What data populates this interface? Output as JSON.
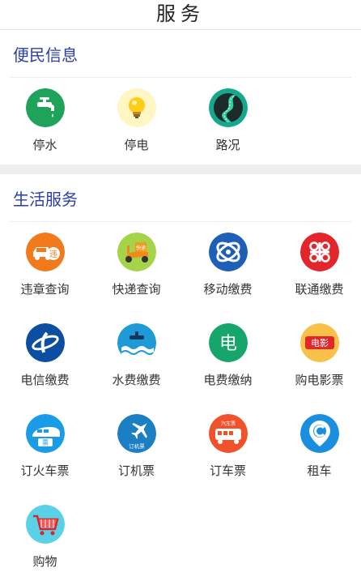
{
  "header": {
    "title": "服务"
  },
  "sections": [
    {
      "title": "便民信息",
      "items": [
        {
          "label": "停水",
          "icon": "water-tap-icon",
          "color": "#1fa35b"
        },
        {
          "label": "停电",
          "icon": "light-bulb-icon",
          "color": "#fff3b0"
        },
        {
          "label": "路况",
          "icon": "road-icon",
          "color": "#159a84"
        }
      ]
    },
    {
      "title": "生活服务",
      "items": [
        {
          "label": "违章查询",
          "icon": "car-violation-icon",
          "color": "#f07a1c"
        },
        {
          "label": "快递查询",
          "icon": "delivery-scooter-icon",
          "color": "#a5d34a"
        },
        {
          "label": "移动缴费",
          "icon": "china-mobile-icon",
          "color": "#1e5fb8"
        },
        {
          "label": "联通缴费",
          "icon": "china-unicom-icon",
          "color": "#e3262c"
        },
        {
          "label": "电信缴费",
          "icon": "china-telecom-icon",
          "color": "#0b4ea2"
        },
        {
          "label": "水费缴费",
          "icon": "water-bill-icon",
          "color": "#1e9bd7"
        },
        {
          "label": "电费缴纳",
          "icon": "electric-bill-icon",
          "color": "#16a56a"
        },
        {
          "label": "购电影票",
          "icon": "movie-ticket-icon",
          "color": "#f5a623"
        },
        {
          "label": "订火车票",
          "icon": "train-ticket-icon",
          "color": "#1a9be8"
        },
        {
          "label": "订机票",
          "icon": "plane-ticket-icon",
          "color": "#1c7fc4"
        },
        {
          "label": "订车票",
          "icon": "bus-ticket-icon",
          "color": "#f0532c"
        },
        {
          "label": "租车",
          "icon": "car-rental-icon",
          "color": "#1a8fe0"
        },
        {
          "label": "购物",
          "icon": "shopping-cart-icon",
          "color": "#5ad1e6"
        }
      ]
    }
  ],
  "icon_text": {
    "violation": "违",
    "express": "快递",
    "electric": "电",
    "movie": "电影",
    "train": "票",
    "plane": "订机票",
    "bus": "汽车票"
  }
}
